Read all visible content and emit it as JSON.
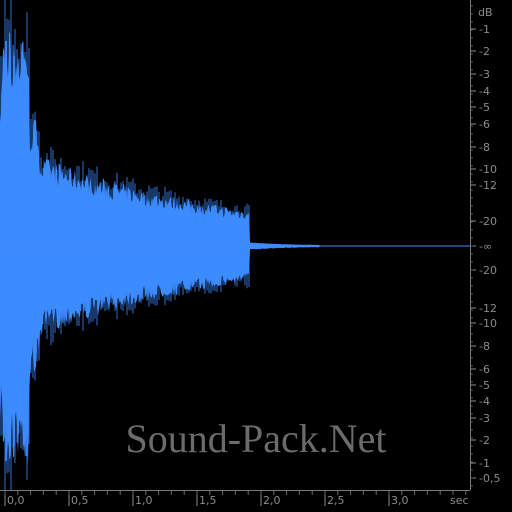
{
  "window": {
    "background": "#000000",
    "panel_color": "#2b2b2b",
    "tick_color": "#8a8a8a",
    "waveform_color": "#3d8bff"
  },
  "db_axis": {
    "unit_label": "dB",
    "upper_labels": [
      "-1",
      "-2",
      "-3",
      "-4",
      "-5",
      "-6",
      "-8",
      "-10",
      "-12",
      "-20"
    ],
    "center_label": "-∞",
    "lower_labels": [
      "-20",
      "-12",
      "-10",
      "-8",
      "-6",
      "-5",
      "-4",
      "-3",
      "-2",
      "-1",
      "-0,5"
    ]
  },
  "time_axis": {
    "unit_label": "sec",
    "labels": [
      "0,0",
      "0,5",
      "1,0",
      "1,5",
      "2,0",
      "2,5",
      "3,0"
    ]
  },
  "watermark": {
    "text": "Sound-Pack.Net"
  }
}
